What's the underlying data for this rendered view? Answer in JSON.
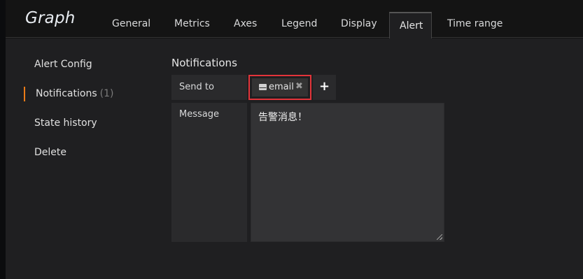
{
  "header": {
    "title": "Graph",
    "tabs": [
      "General",
      "Metrics",
      "Axes",
      "Legend",
      "Display",
      "Alert",
      "Time range"
    ],
    "active_tab": "Alert"
  },
  "sidebar": {
    "items": [
      {
        "label": "Alert Config"
      },
      {
        "label": "Notifications",
        "count": "(1)"
      },
      {
        "label": "State history"
      },
      {
        "label": "Delete"
      }
    ]
  },
  "notifications": {
    "title": "Notifications",
    "send_to_label": "Send to",
    "channels": [
      {
        "name": "email",
        "icon": "envelope-icon"
      }
    ],
    "remove_glyph": "✖",
    "add_glyph": "+",
    "message_label": "Message",
    "message_value": "告警消息！"
  },
  "colors": {
    "accent": "#eb7b18",
    "highlight": "#e3343a",
    "background": "#1f1f21",
    "header": "#141414"
  }
}
